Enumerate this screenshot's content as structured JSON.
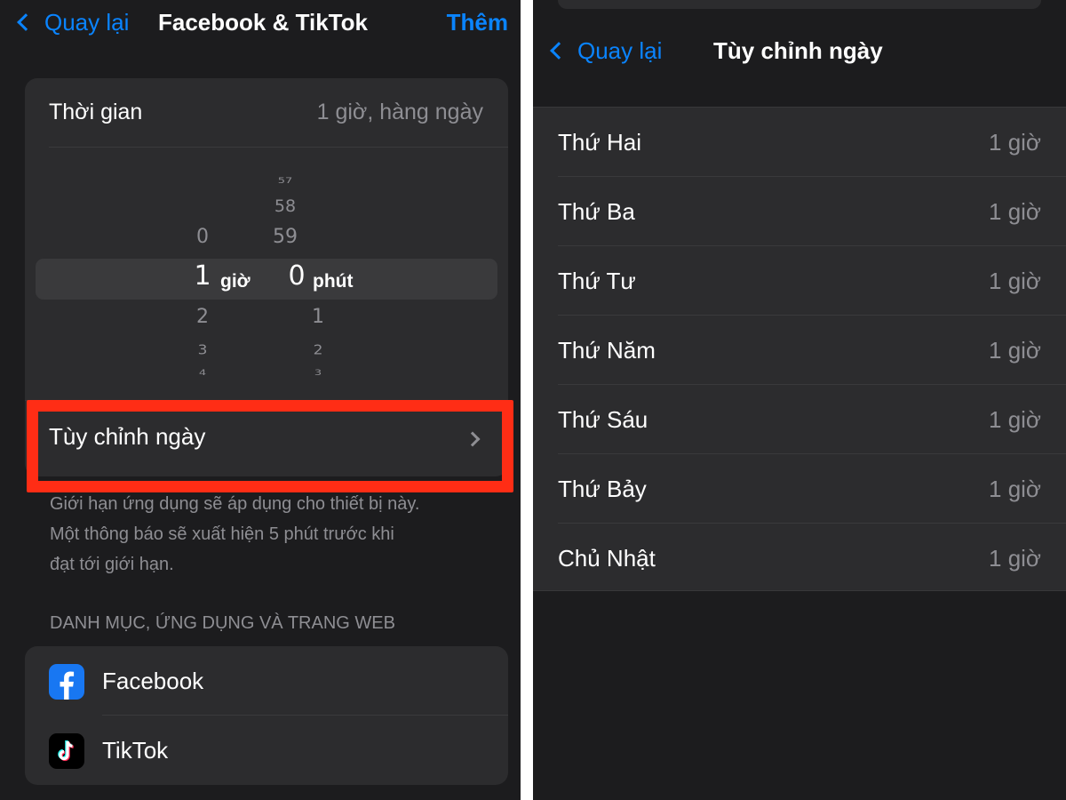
{
  "left": {
    "nav": {
      "back_label": "Quay lại",
      "title": "Facebook & TikTok",
      "action_label": "Thêm"
    },
    "time_row": {
      "label": "Thời gian",
      "value": "1 giờ, hàng ngày"
    },
    "picker": {
      "hours": {
        "above": [
          "0"
        ],
        "selected": "1",
        "below": [
          "2",
          "3",
          "4"
        ],
        "unit": "giờ"
      },
      "minutes": {
        "above": [
          "57",
          "58",
          "59"
        ],
        "selected": "0",
        "below": [
          "1",
          "2",
          "3"
        ],
        "unit": "phút"
      }
    },
    "custom_days_row": {
      "label": "Tùy chỉnh ngày"
    },
    "footnote_lines": [
      "Giới hạn ứng dụng sẽ áp dụng cho thiết bị này.",
      "Một thông báo sẽ xuất hiện 5 phút trước khi",
      "đạt tới giới hạn."
    ],
    "section_header": "DANH MỤC, ỨNG DỤNG VÀ TRANG WEB",
    "apps": [
      {
        "name": "Facebook"
      },
      {
        "name": "TikTok"
      }
    ]
  },
  "right": {
    "nav": {
      "back_label": "Quay lại",
      "title": "Tùy chỉnh ngày"
    },
    "days": [
      {
        "name": "Thứ Hai",
        "value": "1 giờ"
      },
      {
        "name": "Thứ Ba",
        "value": "1 giờ"
      },
      {
        "name": "Thứ Tư",
        "value": "1 giờ"
      },
      {
        "name": "Thứ Năm",
        "value": "1 giờ"
      },
      {
        "name": "Thứ Sáu",
        "value": "1 giờ"
      },
      {
        "name": "Thứ Bảy",
        "value": "1 giờ"
      },
      {
        "name": "Chủ Nhật",
        "value": "1 giờ"
      }
    ]
  },
  "colors": {
    "accent": "#0a84ff",
    "highlight": "#ff2d15",
    "background": "#1c1c1e",
    "card": "#2c2c2e",
    "secondary_text": "#8e8e93"
  },
  "icons": [
    "chevron-left-icon",
    "chevron-right-icon",
    "facebook-icon",
    "tiktok-icon"
  ]
}
